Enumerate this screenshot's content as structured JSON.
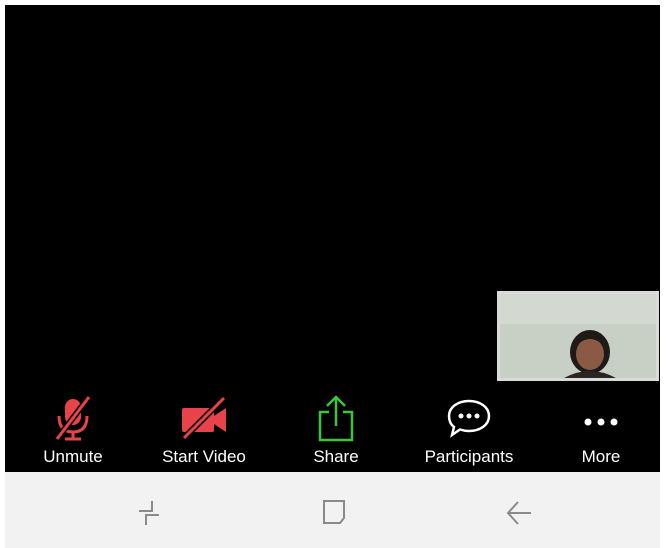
{
  "toolbar": {
    "buttons": [
      {
        "label": "Unmute",
        "icon": "muted-microphone-icon",
        "color": "#e8434a"
      },
      {
        "label": "Start Video",
        "icon": "video-off-icon",
        "color": "#e8434a"
      },
      {
        "label": "Share",
        "icon": "share-screen-icon",
        "color": "#3ec43e"
      },
      {
        "label": "Participants",
        "icon": "participants-chat-icon",
        "color": "#ffffff"
      },
      {
        "label": "More",
        "icon": "more-dots-icon",
        "color": "#ffffff"
      }
    ]
  },
  "navbar": {
    "buttons": [
      {
        "icon": "recent-apps-icon"
      },
      {
        "icon": "home-icon"
      },
      {
        "icon": "back-icon"
      }
    ]
  },
  "colors": {
    "meeting_background": "#000000",
    "navbar_background": "#f2f2f2",
    "muted_red": "#e8434a",
    "share_green": "#3ec43e"
  }
}
